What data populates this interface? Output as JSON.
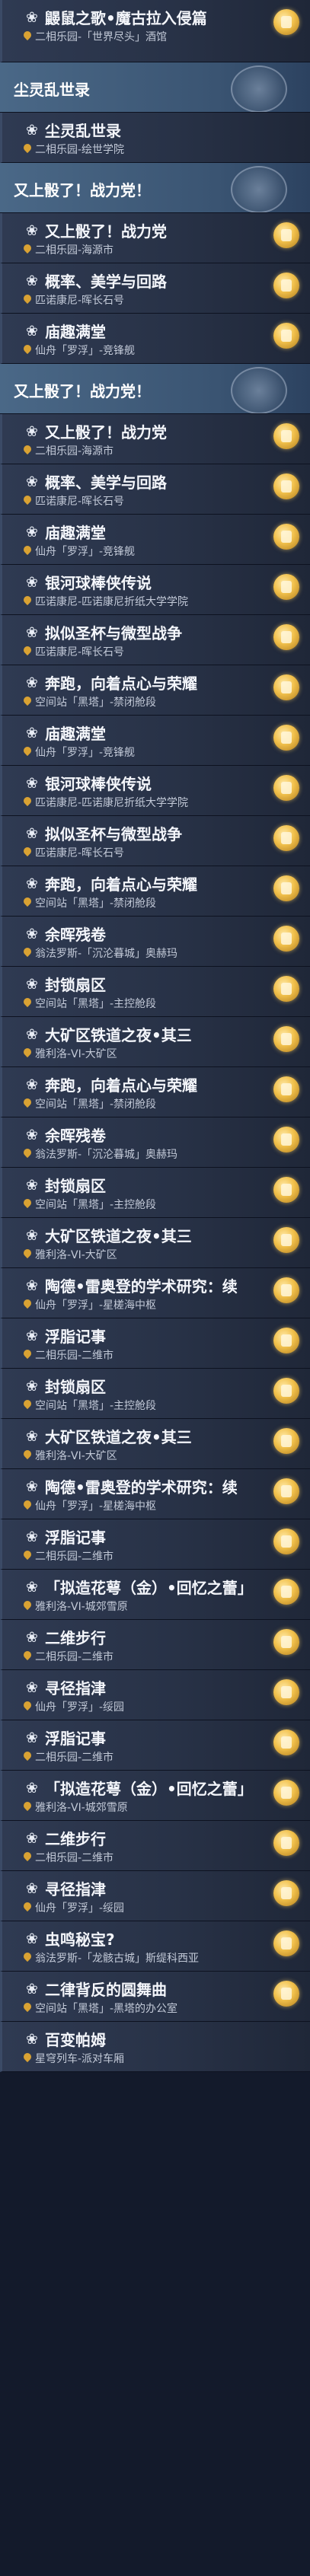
{
  "rows": [
    {
      "type": "quest",
      "title": "鼹鼠之歌•魔古拉入侵篇",
      "location": "二相乐园-「世界尽头」酒馆",
      "badge": true
    },
    {
      "type": "header",
      "title": "尘灵乱世录"
    },
    {
      "type": "quest",
      "title": "尘灵乱世录",
      "location": "二相乐园-绘世学院",
      "badge": false
    },
    {
      "type": "header",
      "title": "又上骰了！战力党！"
    },
    {
      "type": "quest",
      "title": "又上骰了！战力党",
      "location": "二相乐园-海源市",
      "badge": true
    },
    {
      "type": "quest",
      "title": "概率、美学与回路",
      "location": "匹诺康尼-晖长石号",
      "badge": true
    },
    {
      "type": "quest",
      "title": "庙趣满堂",
      "location": "仙舟「罗浮」-竞锋舰",
      "badge": true
    },
    {
      "type": "header",
      "title": "又上骰了！战力党！"
    },
    {
      "type": "quest",
      "title": "又上骰了！战力党",
      "location": "二相乐园-海源市",
      "badge": true
    },
    {
      "type": "quest",
      "title": "概率、美学与回路",
      "location": "匹诺康尼-晖长石号",
      "badge": true
    },
    {
      "type": "quest",
      "title": "庙趣满堂",
      "location": "仙舟「罗浮」-竞锋舰",
      "badge": true
    },
    {
      "type": "quest",
      "title": "银河球棒侠传说",
      "location": "匹诺康尼-匹诺康尼折纸大学学院",
      "badge": true
    },
    {
      "type": "quest",
      "title": "拟似圣杯与微型战争",
      "location": "匹诺康尼-晖长石号",
      "badge": true
    },
    {
      "type": "quest",
      "title": "奔跑，向着点心与荣耀",
      "location": "空间站「黑塔」-禁闭舱段",
      "badge": true
    },
    {
      "type": "quest",
      "title": "庙趣满堂",
      "location": "仙舟「罗浮」-竞锋舰",
      "badge": true
    },
    {
      "type": "quest",
      "title": "银河球棒侠传说",
      "location": "匹诺康尼-匹诺康尼折纸大学学院",
      "badge": true
    },
    {
      "type": "quest",
      "title": "拟似圣杯与微型战争",
      "location": "匹诺康尼-晖长石号",
      "badge": true
    },
    {
      "type": "quest",
      "title": "奔跑，向着点心与荣耀",
      "location": "空间站「黑塔」-禁闭舱段",
      "badge": true
    },
    {
      "type": "quest",
      "title": "余晖残卷",
      "location": "翁法罗斯-「沉沦暮城」奥赫玛",
      "badge": true
    },
    {
      "type": "quest",
      "title": "封锁扇区",
      "location": "空间站「黑塔」-主控舱段",
      "badge": true
    },
    {
      "type": "quest",
      "title": "大矿区铁道之夜•其三",
      "location": "雅利洛-VI-大矿区",
      "badge": true
    },
    {
      "type": "quest",
      "title": "奔跑，向着点心与荣耀",
      "location": "空间站「黑塔」-禁闭舱段",
      "badge": true
    },
    {
      "type": "quest",
      "title": "余晖残卷",
      "location": "翁法罗斯-「沉沦暮城」奥赫玛",
      "badge": true
    },
    {
      "type": "quest",
      "title": "封锁扇区",
      "location": "空间站「黑塔」-主控舱段",
      "badge": true
    },
    {
      "type": "quest",
      "title": "大矿区铁道之夜•其三",
      "location": "雅利洛-VI-大矿区",
      "badge": true
    },
    {
      "type": "quest",
      "title": "陶德•雷奥登的学术研究：续",
      "location": "仙舟「罗浮」-星槎海中枢",
      "badge": true
    },
    {
      "type": "quest",
      "title": "浮脂记事",
      "location": "二相乐园-二维市",
      "badge": true
    },
    {
      "type": "quest",
      "title": "封锁扇区",
      "location": "空间站「黑塔」-主控舱段",
      "badge": true
    },
    {
      "type": "quest",
      "title": "大矿区铁道之夜•其三",
      "location": "雅利洛-VI-大矿区",
      "badge": true
    },
    {
      "type": "quest",
      "title": "陶德•雷奥登的学术研究：续",
      "location": "仙舟「罗浮」-星槎海中枢",
      "badge": true
    },
    {
      "type": "quest",
      "title": "浮脂记事",
      "location": "二相乐园-二维市",
      "badge": true
    },
    {
      "type": "quest",
      "title": "「拟造花萼（金）•回忆之蕾」",
      "location": "雅利洛-VI-城郊雪原",
      "badge": true
    },
    {
      "type": "quest",
      "title": "二维步行",
      "location": "二相乐园-二维市",
      "badge": true
    },
    {
      "type": "quest",
      "title": "寻径指津",
      "location": "仙舟「罗浮」-绥园",
      "badge": true
    },
    {
      "type": "quest",
      "title": "浮脂记事",
      "location": "二相乐园-二维市",
      "badge": true
    },
    {
      "type": "quest",
      "title": "「拟造花萼（金）•回忆之蕾」",
      "location": "雅利洛-VI-城郊雪原",
      "badge": true
    },
    {
      "type": "quest",
      "title": "二维步行",
      "location": "二相乐园-二维市",
      "badge": true
    },
    {
      "type": "quest",
      "title": "寻径指津",
      "location": "仙舟「罗浮」-绥园",
      "badge": true
    },
    {
      "type": "quest",
      "title": "虫鸣秘宝?",
      "location": "翁法罗斯-「龙骸古城」斯缇科西亚",
      "badge": true
    },
    {
      "type": "quest",
      "title": "二律背反的圆舞曲",
      "location": "空间站「黑塔」-黑塔的办公室",
      "badge": true
    },
    {
      "type": "quest",
      "title": "百变帕姆",
      "location": "星穹列车-派对车厢",
      "badge": false
    }
  ]
}
